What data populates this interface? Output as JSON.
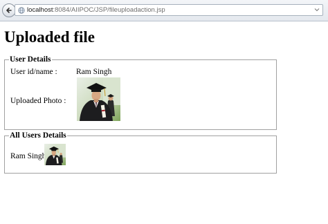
{
  "browser": {
    "url_host": "localhost",
    "url_path": ":8084/AIIPOC/JSP/fileuploadaction.jsp"
  },
  "page": {
    "title": "Uploaded file"
  },
  "user_details": {
    "legend": "User Details",
    "user_id_label": "User id/name :",
    "user_id_value": "Ram Singh",
    "photo_label": "Uploaded Photo :",
    "photo_alt": "graduate-photo"
  },
  "all_users": {
    "legend": "All Users Details",
    "users": [
      {
        "name": "Ram Singh",
        "photo": "graduate-photo"
      }
    ]
  },
  "colors": {
    "chrome_bg": "#e4e8ee",
    "fieldset_border": "#a0a0a0",
    "url_path": "#6e6e6e"
  }
}
